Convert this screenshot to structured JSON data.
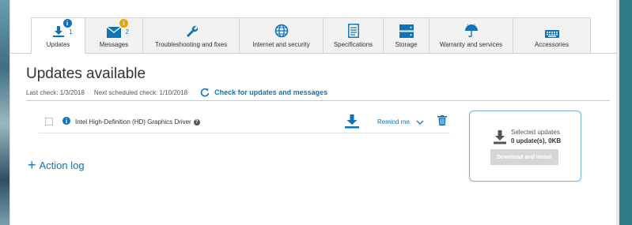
{
  "tabs": [
    {
      "label": "Updates",
      "count": "1",
      "icon": "download-icon",
      "active": true
    },
    {
      "label": "Messages",
      "count": "2",
      "icon": "envelope-icon",
      "active": false
    },
    {
      "label": "Troubleshooting and fixes",
      "icon": "wrench-icon",
      "active": false
    },
    {
      "label": "Internet and security",
      "icon": "globe-icon",
      "active": false
    },
    {
      "label": "Specifications",
      "icon": "document-icon",
      "active": false
    },
    {
      "label": "Storage",
      "icon": "storage-icon",
      "active": false
    },
    {
      "label": "Warranty and services",
      "icon": "umbrella-icon",
      "active": false
    },
    {
      "label": "Accessories",
      "icon": "keyboard-icon",
      "active": false
    }
  ],
  "main": {
    "title": "Updates available",
    "last_check": "Last check: 1/3/2018",
    "next_check": "Next scheduled check: 1/10/2018",
    "check_link": "Check for updates and messages"
  },
  "updates": [
    {
      "name": "Intel High-Definition (HD) Graphics Driver",
      "remind_label": "Remind me"
    }
  ],
  "action_log": "Action log",
  "panel": {
    "selected_label": "Selected updates",
    "count_label": "0 update(s), 0KB",
    "button_label": "Download and install"
  },
  "colors": {
    "accent": "#0f73b8",
    "badge_orange": "#e8a300",
    "disabled_button": "#d6d6d6"
  }
}
